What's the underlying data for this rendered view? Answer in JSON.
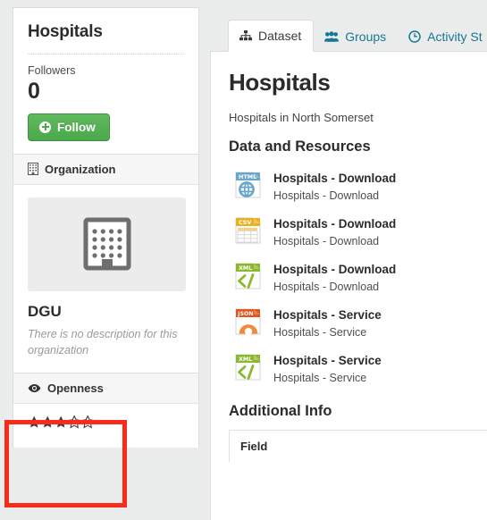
{
  "sidebar": {
    "title": "Hospitals",
    "followers": {
      "label": "Followers",
      "count": "0"
    },
    "follow_button": "Follow",
    "organization": {
      "header": "Organization",
      "header_icon": "building-icon",
      "thumb_icon": "building-placeholder-icon",
      "name": "DGU",
      "description": "There is no description for this organization"
    },
    "openness": {
      "header": "Openness",
      "header_icon": "eye-icon",
      "stars_filled": 3,
      "stars_total": 5,
      "filled_glyph": "★",
      "empty_glyph": "☆"
    }
  },
  "annotation": {
    "name": "openness-highlight-box",
    "color": "#f92b1c"
  },
  "main": {
    "tabs": [
      {
        "label": "Dataset",
        "icon": "sitemap-icon",
        "active": true
      },
      {
        "label": "Groups",
        "icon": "users-icon",
        "active": false
      },
      {
        "label": "Activity St",
        "icon": "clock-icon",
        "active": false
      }
    ],
    "dataset_title": "Hospitals",
    "dataset_notes": "Hospitals in North Somerset",
    "resources_heading": "Data and Resources",
    "resources": [
      {
        "format": "HTML",
        "title": "Hospitals - Download",
        "description": "Hospitals - Download",
        "icon": "html-file-icon"
      },
      {
        "format": "CSV",
        "title": "Hospitals - Download",
        "description": "Hospitals - Download",
        "icon": "csv-file-icon"
      },
      {
        "format": "XML",
        "title": "Hospitals - Download",
        "description": "Hospitals - Download",
        "icon": "xml-file-icon"
      },
      {
        "format": "JSON",
        "title": "Hospitals - Service",
        "description": "Hospitals - Service",
        "icon": "json-file-icon"
      },
      {
        "format": "XML",
        "title": "Hospitals - Service",
        "description": "Hospitals - Service",
        "icon": "xml-file-icon"
      }
    ],
    "additional_info_heading": "Additional Info",
    "additional_info_columns": [
      "Field"
    ]
  },
  "colors": {
    "accent_link": "#187696",
    "follow_green": "#4ca84c",
    "annotation_red": "#f92b1c",
    "page_bg": "#ebecec"
  }
}
